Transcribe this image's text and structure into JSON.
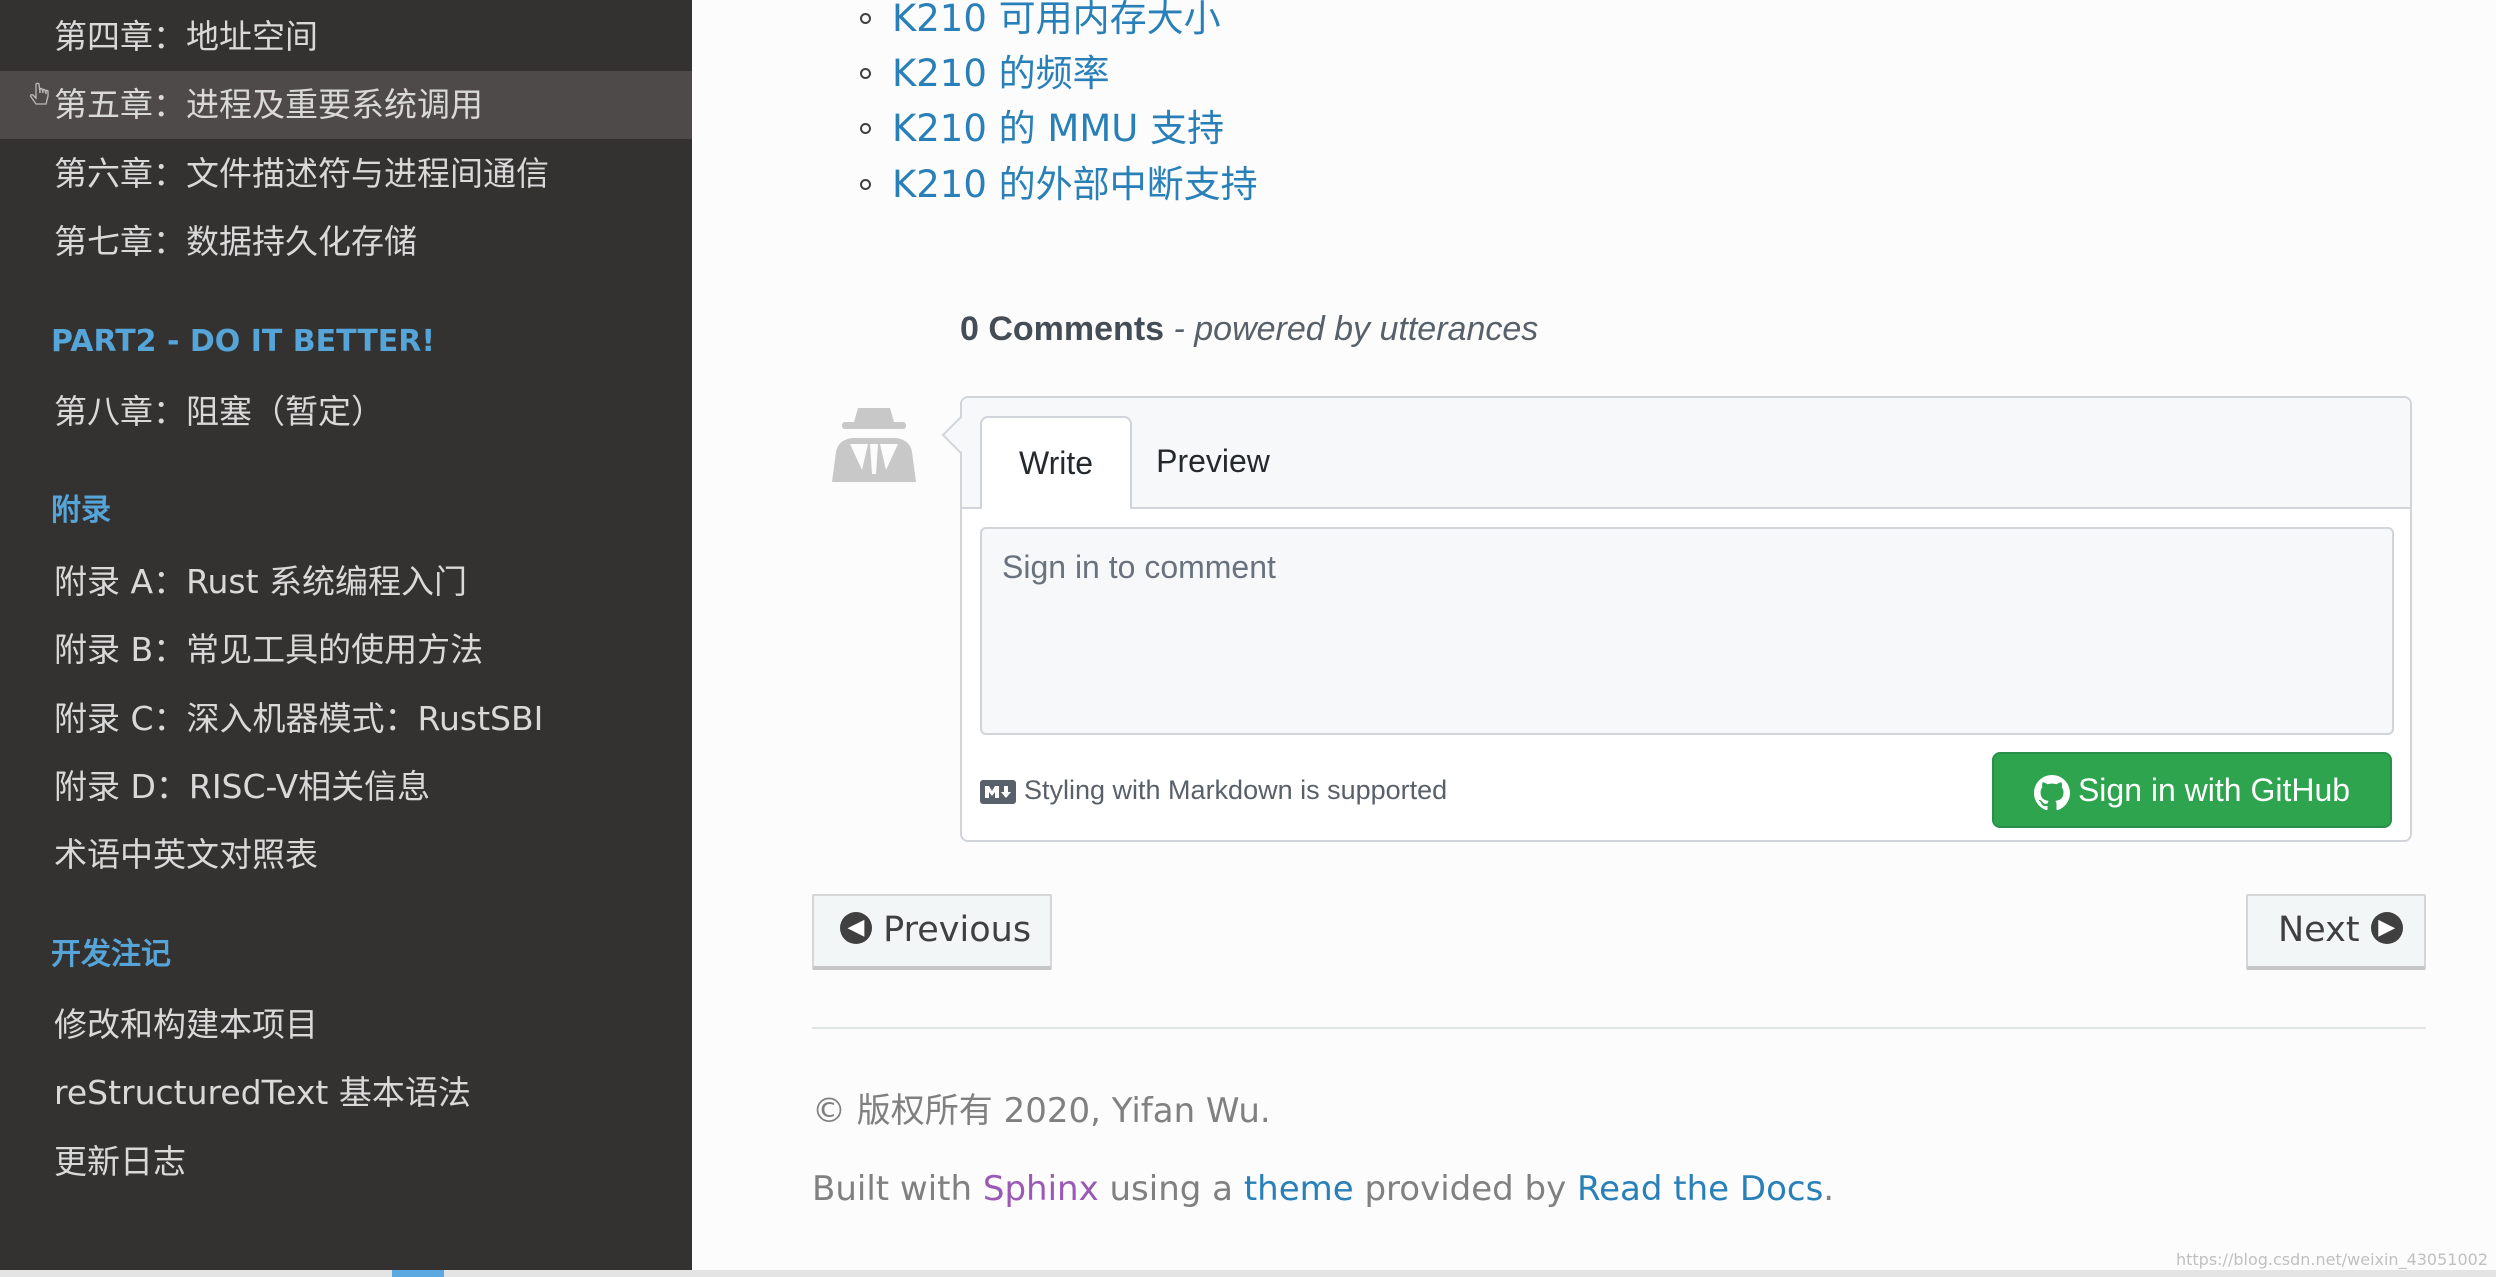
{
  "sidebar": {
    "items_top": [
      {
        "label": "第四章：地址空间"
      },
      {
        "label": "第五章：进程及重要系统调用"
      },
      {
        "label": "第六章：文件描述符与进程间通信"
      },
      {
        "label": "第七章：数据持久化存储"
      }
    ],
    "section_part2": "PART2 - DO IT BETTER!",
    "items_part2": [
      {
        "label": "第八章：阻塞（暂定）"
      }
    ],
    "section_appendix": "附录",
    "items_appendix": [
      {
        "label": "附录 A：Rust 系统编程入门"
      },
      {
        "label": "附录 B：常见工具的使用方法"
      },
      {
        "label": "附录 C：深入机器模式：RustSBI"
      },
      {
        "label": "附录 D：RISC-V相关信息"
      },
      {
        "label": "术语中英文对照表"
      }
    ],
    "section_devnotes": "开发注记",
    "items_devnotes": [
      {
        "label": "修改和构建本项目"
      },
      {
        "label": "reStructuredText 基本语法"
      },
      {
        "label": "更新日志"
      }
    ]
  },
  "toc": [
    "K210 可用内存大小",
    "K210 的频率",
    "K210 的 MMU 支持",
    "K210 的外部中断支持"
  ],
  "comments": {
    "count": "0 Comments",
    "powered": " - powered by utterances",
    "tab_write": "Write",
    "tab_preview": "Preview",
    "placeholder": "Sign in to comment",
    "markdown_hint": "Styling with Markdown is supported",
    "signin_label": "Sign in with GitHub"
  },
  "pager": {
    "previous": "Previous",
    "next": "Next"
  },
  "footer": {
    "copyright": "© 版权所有 2020, Yifan Wu.",
    "built_with": "Built with ",
    "sphinx": "Sphinx",
    "using_a": " using a ",
    "theme": "theme",
    "provided_by": " provided by ",
    "rtd": "Read the Docs",
    "period": "."
  },
  "watermark": "https://blog.csdn.net/weixin_43051002",
  "colors": {
    "sidebar_bg": "#343131",
    "caption": "#55a5d9",
    "link": "#2980b9",
    "sphinx": "#9b59b6",
    "github_green": "#2ea44f"
  }
}
